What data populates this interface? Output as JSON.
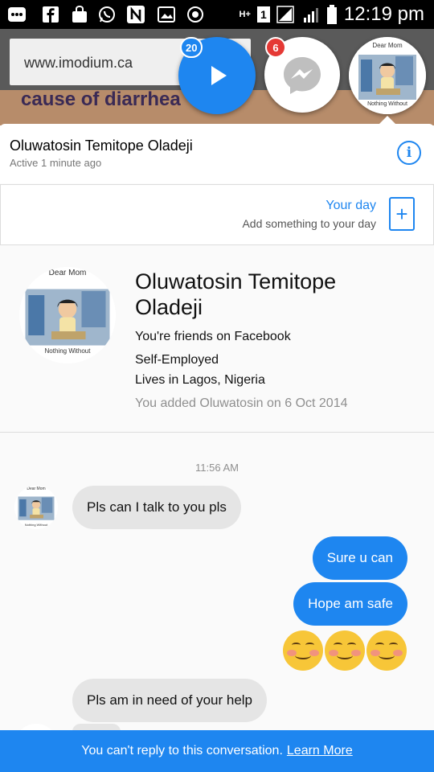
{
  "status_bar": {
    "time": "12:19 pm",
    "network": "H+",
    "sim": "1",
    "icons": [
      "bbm-icon",
      "facebook-icon",
      "bag-icon",
      "whatsapp-icon",
      "nfc-icon",
      "gallery-icon",
      "camera-icon"
    ]
  },
  "browser": {
    "url": "www.imodium.ca",
    "headline": "cause of diarrhea"
  },
  "chat_heads": {
    "play_badge": "20",
    "messenger_badge": "6",
    "avatar_caption_top": "Dear Mom",
    "avatar_caption_bottom": "Nothing Without"
  },
  "conversation_header": {
    "name": "Oluwatosin Temitope Oladeji",
    "status": "Active 1 minute ago"
  },
  "your_day": {
    "title": "Your day",
    "subtitle": "Add something to your day"
  },
  "profile": {
    "name": "Oluwatosin Temitope Oladeji",
    "friends": "You're friends on Facebook",
    "work": "Self-Employed",
    "location": "Lives in Lagos, Nigeria",
    "added": "You added Oluwatosin on 6 Oct 2014",
    "avatar_caption_top": "Dear Mom",
    "avatar_caption_bottom": "Nothing Without"
  },
  "messages": {
    "timestamp": "11:56 AM",
    "in_1": "Pls can I talk to you pls",
    "out_1": "Sure u can",
    "out_2": "Hope am safe",
    "emoji_reaction": "😊😊😊",
    "in_2": "Pls am in need of your help",
    "avatar_caption_top": "Dear Mom",
    "avatar_caption_bottom": "Nothing Without"
  },
  "footer": {
    "notice": "You can't reply to this conversation.",
    "link": "Learn More"
  },
  "colors": {
    "accent": "#1e86f0",
    "badge_red": "#e53935",
    "incoming_bubble": "#e5e5e5"
  }
}
